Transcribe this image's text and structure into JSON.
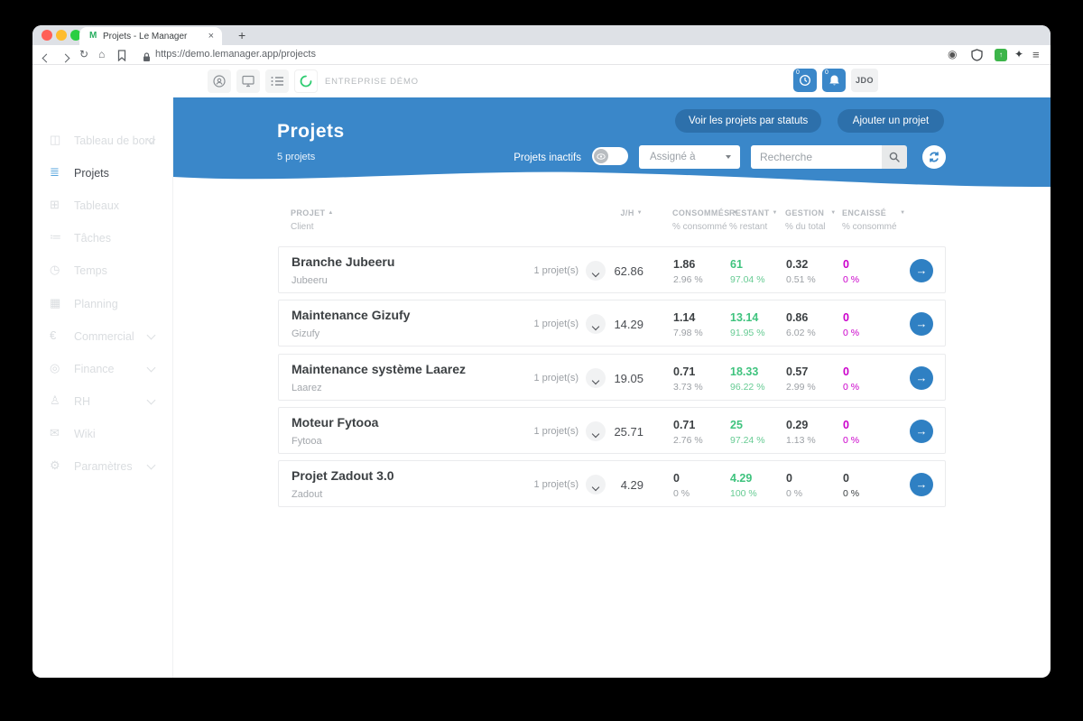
{
  "colors": {
    "accent_blue": "#3a87c9",
    "button_blue": "#2d70ab",
    "green": "#3fc37e",
    "magenta": "#cb00cb"
  },
  "browser": {
    "tab_title": "Projets - Le Manager",
    "favicon_glyph": "M",
    "close_tab": "×",
    "new_tab": "+",
    "url": "https://demo.lemanager.app/projects",
    "refresh_glyph": "↻",
    "home_glyph": "⌂",
    "media_glyph": "◉",
    "puzzle_glyph": "✦",
    "menu_glyph": "≡",
    "ext_glyph": "↑"
  },
  "appbar": {
    "company": "ENTREPRISE DÉMO",
    "clock_badge": "0",
    "bell_badge": "0",
    "avatar": "JDO"
  },
  "sidebar": {
    "items": [
      {
        "id": "tableau-de-bord",
        "label": "Tableau de bord",
        "icon": "dashboard-icon",
        "glyph": "◫",
        "chevron": true,
        "active": false
      },
      {
        "id": "projets",
        "label": "Projets",
        "icon": "list-icon",
        "glyph": "≣",
        "chevron": false,
        "active": true
      },
      {
        "id": "tableaux",
        "label": "Tableaux",
        "icon": "grid-icon",
        "glyph": "⊞",
        "chevron": false,
        "active": false
      },
      {
        "id": "taches",
        "label": "Tâches",
        "icon": "tasks-icon",
        "glyph": "≔",
        "chevron": false,
        "active": false
      },
      {
        "id": "temps",
        "label": "Temps",
        "icon": "clock-icon",
        "glyph": "◷",
        "chevron": false,
        "active": false
      },
      {
        "id": "planning",
        "label": "Planning",
        "icon": "calendar-icon",
        "glyph": "▦",
        "chevron": false,
        "active": false
      },
      {
        "id": "commercial",
        "label": "Commercial",
        "icon": "euro-icon",
        "glyph": "€",
        "chevron": true,
        "active": false
      },
      {
        "id": "finance",
        "label": "Finance",
        "icon": "coin-icon",
        "glyph": "◎",
        "chevron": true,
        "active": false
      },
      {
        "id": "rh",
        "label": "RH",
        "icon": "person-icon",
        "glyph": "♙",
        "chevron": true,
        "active": false
      },
      {
        "id": "wiki",
        "label": "Wiki",
        "icon": "chat-icon",
        "glyph": "✉",
        "chevron": false,
        "active": false
      },
      {
        "id": "parametres",
        "label": "Paramètres",
        "icon": "gear-icon",
        "glyph": "⚙",
        "chevron": true,
        "active": false
      }
    ],
    "dark_mode_glyph": "☾"
  },
  "hero": {
    "title": "Projets",
    "subtitle": "5 projets",
    "btn_statuts": "Voir les projets par statuts",
    "btn_ajouter": "Ajouter un projet",
    "toggle_label": "Projets inactifs",
    "assigne_value": "Assigné à",
    "search_placeholder": "Recherche"
  },
  "table": {
    "headers": {
      "projet": "PROJET",
      "projet_sub": "Client",
      "jh": "J/H",
      "consommes": "CONSOMMÉS",
      "consommes_sub": "% consommé",
      "restant": "RESTANT",
      "restant_sub": "% restant",
      "gestion": "GESTION",
      "gestion_sub": "% du total",
      "encaisse": "ENCAISSÉ",
      "encaisse_sub": "% consommé",
      "sort_up": "▲",
      "sort_down": "▼"
    },
    "row_arrow": "→",
    "rows": [
      {
        "name": "Branche Jubeeru",
        "client": "Jubeeru",
        "count": "1 projet(s)",
        "jh": "62.86",
        "consommes": "1.86",
        "consommes_pct": "2.96 %",
        "restant": "61",
        "restant_pct": "97.04 %",
        "gestion": "0.32",
        "gestion_pct": "0.51 %",
        "encaisse": "0",
        "encaisse_pct": "0 %",
        "encaisse_style": "pink"
      },
      {
        "name": "Maintenance Gizufy",
        "client": "Gizufy",
        "count": "1 projet(s)",
        "jh": "14.29",
        "consommes": "1.14",
        "consommes_pct": "7.98 %",
        "restant": "13.14",
        "restant_pct": "91.95 %",
        "gestion": "0.86",
        "gestion_pct": "6.02 %",
        "encaisse": "0",
        "encaisse_pct": "0 %",
        "encaisse_style": "pink"
      },
      {
        "name": "Maintenance système Laarez",
        "client": "Laarez",
        "count": "1 projet(s)",
        "jh": "19.05",
        "consommes": "0.71",
        "consommes_pct": "3.73 %",
        "restant": "18.33",
        "restant_pct": "96.22 %",
        "gestion": "0.57",
        "gestion_pct": "2.99 %",
        "encaisse": "0",
        "encaisse_pct": "0 %",
        "encaisse_style": "pink"
      },
      {
        "name": "Moteur Fytooa",
        "client": "Fytooa",
        "count": "1 projet(s)",
        "jh": "25.71",
        "consommes": "0.71",
        "consommes_pct": "2.76 %",
        "restant": "25",
        "restant_pct": "97.24 %",
        "gestion": "0.29",
        "gestion_pct": "1.13 %",
        "encaisse": "0",
        "encaisse_pct": "0 %",
        "encaisse_style": "pink"
      },
      {
        "name": "Projet Zadout 3.0",
        "client": "Zadout",
        "count": "1 projet(s)",
        "jh": "4.29",
        "consommes": "0",
        "consommes_pct": "0 %",
        "restant": "4.29",
        "restant_pct": "100 %",
        "gestion": "0",
        "gestion_pct": "0 %",
        "encaisse": "0",
        "encaisse_pct": "0 %",
        "encaisse_style": "dark"
      }
    ]
  }
}
